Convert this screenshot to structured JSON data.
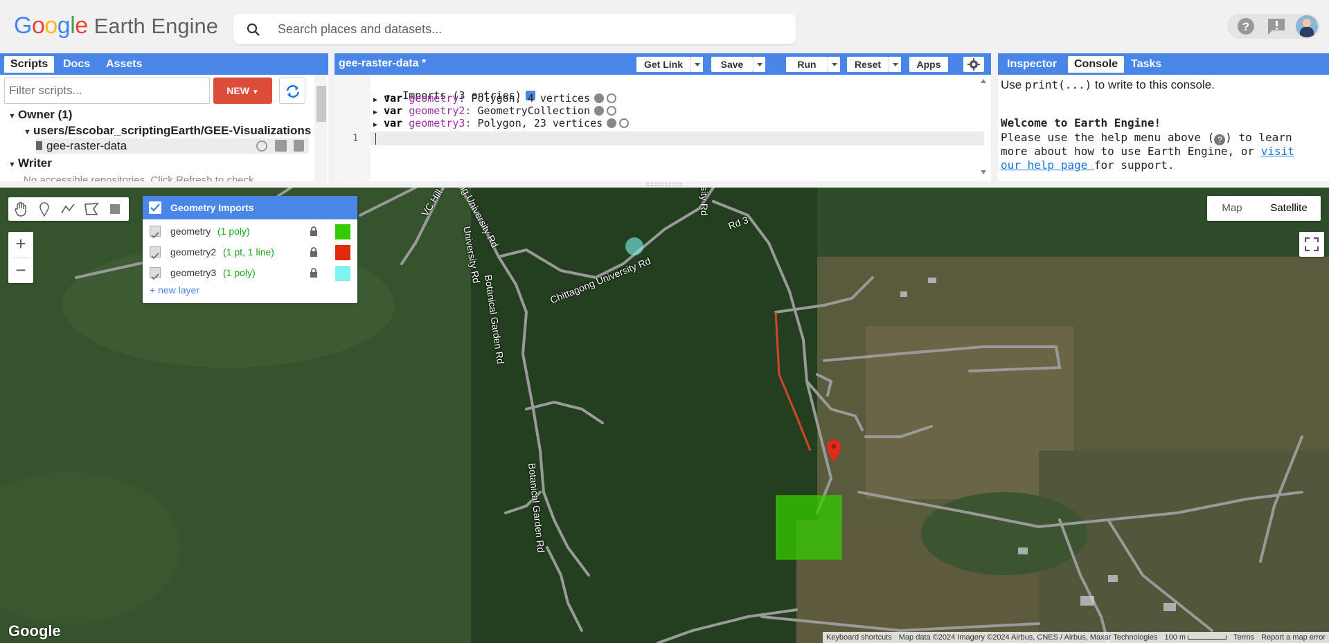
{
  "header": {
    "logo_google": "Google",
    "logo_product": "Earth Engine",
    "search_placeholder": "Search places and datasets..."
  },
  "left_panel": {
    "tabs": [
      "Scripts",
      "Docs",
      "Assets"
    ],
    "filter_placeholder": "Filter scripts...",
    "new_label": "NEW",
    "tree": {
      "owner": "Owner (1)",
      "repo": "users/Escobar_scriptingEarth/GEE-Visualizations",
      "script": "gee-raster-data",
      "writer": "Writer",
      "no_repos": "No accessible repositories. Click Refresh to check"
    }
  },
  "editor": {
    "title": "gee-raster-data *",
    "buttons": {
      "get_link": "Get Link",
      "save": "Save",
      "run": "Run",
      "reset": "Reset",
      "apps": "Apps"
    },
    "imports_header": "Imports (3 entries)",
    "imports": [
      {
        "kw": "var",
        "name": "geometry:",
        "desc": "Polygon, 4 vertices"
      },
      {
        "kw": "var",
        "name": "geometry2:",
        "desc": "GeometryCollection"
      },
      {
        "kw": "var",
        "name": "geometry3:",
        "desc": "Polygon, 23 vertices"
      }
    ],
    "line_number": "1"
  },
  "right_panel": {
    "tabs": [
      "Inspector",
      "Console",
      "Tasks"
    ],
    "hint_prefix": "Use ",
    "hint_code": "print(...)",
    "hint_suffix": " to write to this console.",
    "welcome_title": "Welcome to Earth Engine!",
    "welcome_l1": "Please use the help menu above (",
    "welcome_l1b": ") to learn",
    "welcome_l2": "more about how to use Earth Engine, or ",
    "welcome_link1": "visit",
    "welcome_link2": "our help page ",
    "welcome_l3": "for support."
  },
  "map": {
    "geometry_panel": {
      "title": "Geometry Imports",
      "layers": [
        {
          "name": "geometry",
          "detail": "(1 poly)",
          "color": "#33cc00"
        },
        {
          "name": "geometry2",
          "detail": "(1 pt, 1 line)",
          "color": "#e02a0a"
        },
        {
          "name": "geometry3",
          "detail": "(1 poly)",
          "color": "#7ff4ef"
        }
      ],
      "new_layer": "+ new layer"
    },
    "map_type": {
      "map": "Map",
      "satellite": "Satellite",
      "selected": "Satellite"
    },
    "labels": {
      "vc_hill": "VC Hill",
      "cu_rd_upper": "ong University Rd",
      "cu_rd_left": "University Rd",
      "rd3": "Rd 3",
      "sity_rd": "sity Rd",
      "chittagong_rd": "Chittagong University Rd",
      "botanical_upper": "Botanical Garden Rd",
      "botanical_lower": "Botanical Garden Rd"
    },
    "attribution": {
      "shortcuts": "Keyboard shortcuts",
      "data": "Map data ©2024 Imagery ©2024 Airbus, CNES / Airbus, Maxar Technologies",
      "scale": "100 m",
      "terms": "Terms",
      "report": "Report a map error"
    },
    "google_logo": "Google"
  },
  "colors": {
    "accent": "#4a86e8",
    "new_button": "#dd4b39"
  }
}
